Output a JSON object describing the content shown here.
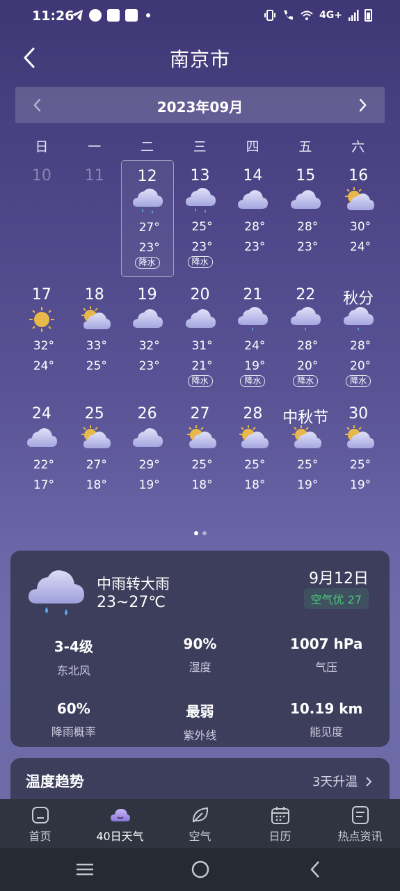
{
  "status": {
    "time": "11:26",
    "network": "4G+"
  },
  "header": {
    "title": "南京市"
  },
  "month": {
    "label": "2023年09月"
  },
  "weekdays": [
    "日",
    "一",
    "二",
    "三",
    "四",
    "五",
    "六"
  ],
  "days": [
    {
      "label": "10",
      "dim": true
    },
    {
      "label": "11",
      "dim": true
    },
    {
      "label": "12",
      "icon": "rain-cloud-icon",
      "hi": "27°",
      "lo": "23°",
      "tag": "降水",
      "selected": true
    },
    {
      "label": "13",
      "icon": "rain-cloud-icon",
      "hi": "25°",
      "lo": "23°",
      "tag": "降水"
    },
    {
      "label": "14",
      "icon": "cloud-icon",
      "hi": "28°",
      "lo": "23°"
    },
    {
      "label": "15",
      "icon": "cloud-icon",
      "hi": "28°",
      "lo": "23°"
    },
    {
      "label": "16",
      "icon": "partly-cloudy-icon",
      "hi": "30°",
      "lo": "24°"
    },
    {
      "label": "17",
      "icon": "sun-icon",
      "hi": "32°",
      "lo": "24°"
    },
    {
      "label": "18",
      "icon": "partly-cloudy-icon",
      "hi": "33°",
      "lo": "25°"
    },
    {
      "label": "19",
      "icon": "cloud-icon",
      "hi": "32°",
      "lo": "23°"
    },
    {
      "label": "20",
      "icon": "cloud-icon",
      "hi": "31°",
      "lo": "21°",
      "tag": "降水"
    },
    {
      "label": "21",
      "icon": "light-rain-icon",
      "hi": "24°",
      "lo": "19°",
      "tag": "降水"
    },
    {
      "label": "22",
      "icon": "light-rain-icon",
      "hi": "28°",
      "lo": "20°",
      "tag": "降水"
    },
    {
      "label": "秋分",
      "icon": "light-rain-icon",
      "hi": "28°",
      "lo": "20°",
      "tag": "降水"
    },
    {
      "label": "24",
      "icon": "cloud-icon",
      "hi": "22°",
      "lo": "17°"
    },
    {
      "label": "25",
      "icon": "partly-cloudy-icon",
      "hi": "27°",
      "lo": "18°"
    },
    {
      "label": "26",
      "icon": "cloud-icon",
      "hi": "29°",
      "lo": "19°"
    },
    {
      "label": "27",
      "icon": "partly-cloudy-icon",
      "hi": "25°",
      "lo": "18°"
    },
    {
      "label": "28",
      "icon": "partly-cloudy-icon",
      "hi": "25°",
      "lo": "18°"
    },
    {
      "label": "中秋节",
      "icon": "partly-cloudy-icon",
      "hi": "25°",
      "lo": "19°"
    },
    {
      "label": "30",
      "icon": "partly-cloudy-icon",
      "hi": "25°",
      "lo": "19°"
    }
  ],
  "detail": {
    "condition": "中雨转大雨",
    "range": "23~27℃",
    "date": "9月12日",
    "aqi": "空气优 27",
    "stats": [
      {
        "value": "3-4级",
        "label": "东北风"
      },
      {
        "value": "90%",
        "label": "湿度"
      },
      {
        "value": "1007 hPa",
        "label": "气压"
      },
      {
        "value": "60%",
        "label": "降雨概率"
      },
      {
        "value": "最弱",
        "label": "紫外线"
      },
      {
        "value": "10.19 km",
        "label": "能见度"
      }
    ]
  },
  "trend": {
    "title": "温度趋势",
    "link": "3天升温"
  },
  "nav": [
    {
      "label": "首页",
      "icon": "home-icon"
    },
    {
      "label": "40日天气",
      "icon": "cloud-moon-icon",
      "active": true
    },
    {
      "label": "空气",
      "icon": "leaf-icon"
    },
    {
      "label": "日历",
      "icon": "calendar-icon"
    },
    {
      "label": "热点资讯",
      "icon": "news-icon"
    }
  ],
  "colors": {
    "aqi_good": "#4ec87a",
    "sun": "#e8b84a"
  }
}
